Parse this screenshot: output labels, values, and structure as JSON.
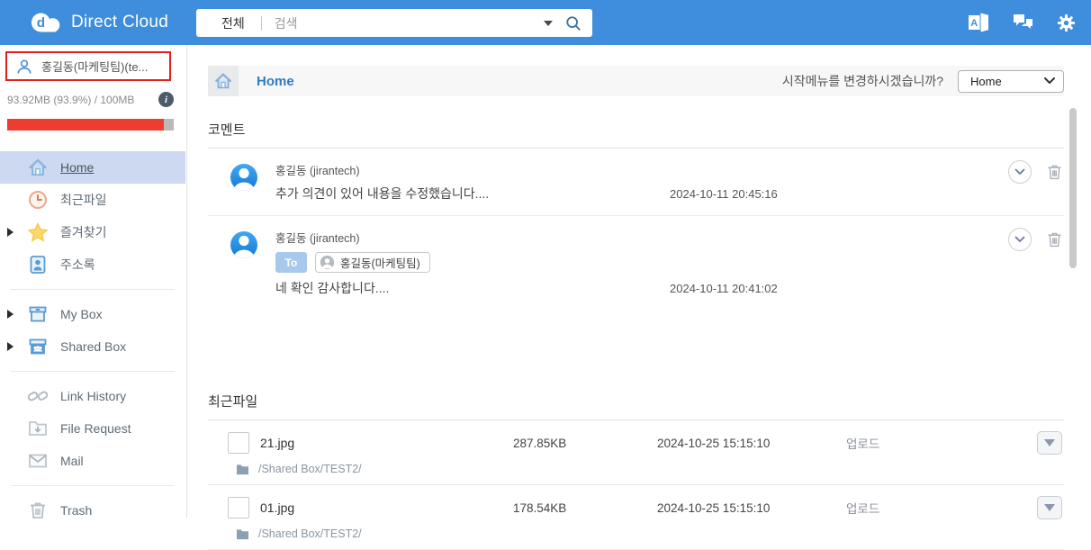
{
  "topbar": {
    "logo_text": "Direct Cloud",
    "search_scope": "전체",
    "search_placeholder": "검색",
    "icons": [
      "office-a-icon",
      "chat-icon",
      "gear-icon"
    ]
  },
  "sidebar": {
    "user_name": "홍길동(마케팅팀)(te...",
    "storage_text": "93.92MB (93.9%) / 100MB",
    "usage_percent": 93.9,
    "menu": [
      {
        "label": "Home",
        "icon": "home-icon",
        "active": true
      },
      {
        "label": "최근파일",
        "icon": "clock-icon"
      },
      {
        "label": "즐겨찾기",
        "icon": "star-icon",
        "expandable": true
      },
      {
        "label": "주소록",
        "icon": "address-book-icon"
      },
      {
        "label": "My Box",
        "icon": "box-icon",
        "expandable": true
      },
      {
        "label": "Shared Box",
        "icon": "shared-box-icon",
        "expandable": true
      },
      {
        "label": "Link History",
        "icon": "link-icon"
      },
      {
        "label": "File Request",
        "icon": "file-request-icon"
      },
      {
        "label": "Mail",
        "icon": "mail-icon"
      },
      {
        "label": "Trash",
        "icon": "trash-icon"
      }
    ]
  },
  "main": {
    "header": {
      "title": "Home",
      "start_menu_prompt": "시작메뉴를 변경하시겠습니까?",
      "start_menu_value": "Home"
    },
    "comments": {
      "title": "코멘트",
      "items": [
        {
          "author": "홍길동 (jirantech)",
          "message": "추가 의견이 있어 내용을 수정했습니다....",
          "timestamp": "2024-10-11 20:45:16"
        },
        {
          "author": "홍길동 (jirantech)",
          "to_label": "To",
          "recipient": "홍길동(마케팅팀)",
          "message": "네 확인 감사합니다....",
          "timestamp": "2024-10-11 20:41:02"
        }
      ]
    },
    "recent_files": {
      "title": "최근파일",
      "items": [
        {
          "name": "21.jpg",
          "size": "287.85KB",
          "date": "2024-10-25 15:15:10",
          "action": "업로드",
          "path": "/Shared Box/TEST2/"
        },
        {
          "name": "01.jpg",
          "size": "178.54KB",
          "date": "2024-10-25 15:15:10",
          "action": "업로드",
          "path": "/Shared Box/TEST2/"
        }
      ]
    }
  },
  "colors": {
    "topbar_blue": "#3e8edd",
    "alert_red_border": "#e01f1f",
    "progress_red": "#ee3c30",
    "active_item_bg": "#ccd9f0",
    "link_blue": "#3279c6",
    "to_badge_blue": "#a9c9ec"
  }
}
